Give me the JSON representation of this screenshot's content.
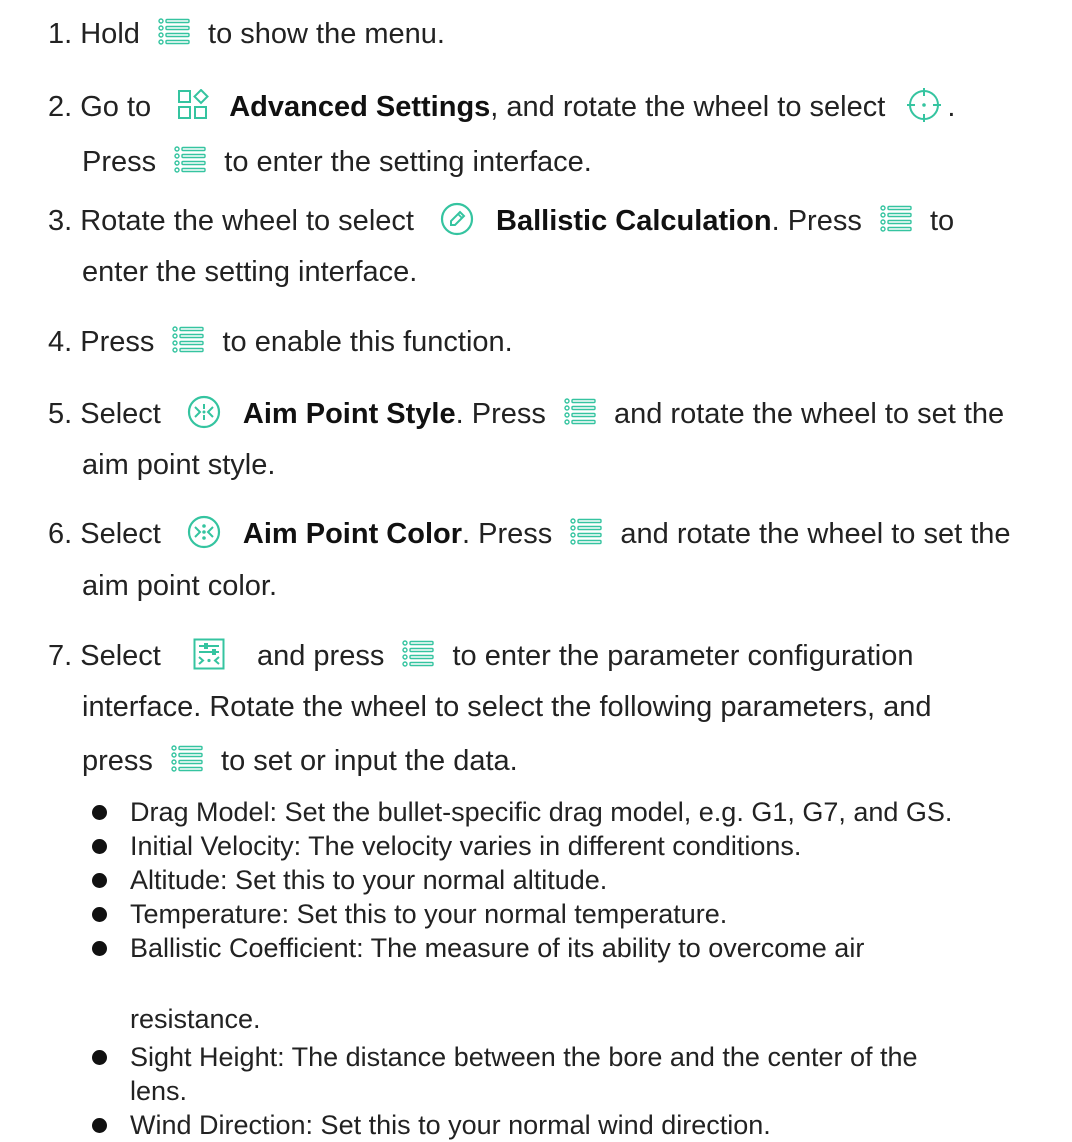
{
  "accent_color": "#35c4a0",
  "icons": {
    "menu": "menu-list-icon",
    "advanced": "advanced-settings-icon",
    "crosshair": "crosshair-icon",
    "ballistic": "ballistic-calculation-icon",
    "aim_style": "aim-point-style-icon",
    "aim_color": "aim-point-color-icon",
    "params": "parameter-config-icon"
  },
  "steps": {
    "s1": {
      "a": "1. Hold",
      "b": "to show the menu."
    },
    "s2": {
      "a": "2. Go to",
      "bold": "Advanced Settings",
      "b": ", and rotate the wheel to select",
      "c": ".",
      "d": "Press",
      "e": "to enter the setting interface."
    },
    "s3": {
      "a": "3. Rotate the wheel to select",
      "bold": "Ballistic Calculation",
      "b": ". Press",
      "c": "to",
      "d": "enter the setting interface."
    },
    "s4": {
      "a": "4. Press",
      "b": "to enable this function."
    },
    "s5": {
      "a": "5. Select",
      "bold": "Aim Point Style",
      "b": ". Press",
      "c": "and rotate the wheel to set the",
      "d": "aim point style."
    },
    "s6": {
      "a": "6. Select",
      "bold": "Aim Point Color",
      "b": ". Press",
      "c": "and rotate the wheel to set the",
      "d": "aim point color."
    },
    "s7": {
      "a": "7. Select",
      "b": "and press",
      "c": "to enter the parameter configuration",
      "d": "interface. Rotate the wheel to select the following parameters, and",
      "e": "press",
      "f": "to set or input the data."
    }
  },
  "bullets": [
    "Drag Model: Set the bullet-specific drag model, e.g. G1, G7, and GS.",
    "Initial Velocity: The velocity varies in different conditions.",
    "Altitude: Set this to your normal altitude.",
    "Temperature: Set this to your normal temperature.",
    "Ballistic Coefficient: The measure of its ability to overcome air",
    "resistance.",
    "Sight Height: The distance between the bore and the center of the",
    "lens.",
    "Wind Direction: Set this to your normal wind direction."
  ]
}
